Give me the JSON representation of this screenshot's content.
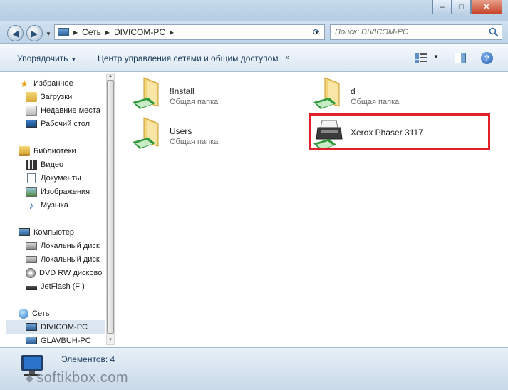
{
  "window": {
    "minimize_glyph": "–",
    "maximize_glyph": "□",
    "close_glyph": "✕"
  },
  "navigation": {
    "back_glyph": "◀",
    "forward_glyph": "▶",
    "address": {
      "crumbs": [
        "Сеть",
        "DIVICOM-PC"
      ]
    },
    "refresh_glyph": "⟳",
    "search": {
      "placeholder": "Поиск: DIVICOM-PC"
    }
  },
  "toolbar": {
    "organize_label": "Упорядочить",
    "network_center_label": "Центр управления сетями и общим доступом",
    "more_glyph": "»",
    "help_glyph": "?"
  },
  "sidebar": {
    "favorites": {
      "label": "Избранное",
      "items": [
        "Загрузки",
        "Недавние места",
        "Рабочий стол"
      ]
    },
    "libraries": {
      "label": "Библиотеки",
      "items": [
        "Видео",
        "Документы",
        "Изображения",
        "Музыка"
      ]
    },
    "computer": {
      "label": "Компьютер",
      "items": [
        "Локальный диск",
        "Локальный диск",
        "DVD RW дисково",
        "JetFlash (F:)"
      ]
    },
    "network": {
      "label": "Сеть",
      "items": [
        "DIVICOM-PC",
        "GLAVBUH-PC"
      ]
    }
  },
  "shares": [
    {
      "name": "!Install",
      "type": "Общая папка"
    },
    {
      "name": "d",
      "type": "Общая папка"
    },
    {
      "name": "Users",
      "type": "Общая папка"
    },
    {
      "name": "Xerox Phaser 3117",
      "type": ""
    }
  ],
  "status": {
    "count_text": "Элементов: 4"
  },
  "watermark": {
    "text": "softikbox.com"
  },
  "colors": {
    "highlight": "#e2202a",
    "accent": "#1e3d5c"
  }
}
